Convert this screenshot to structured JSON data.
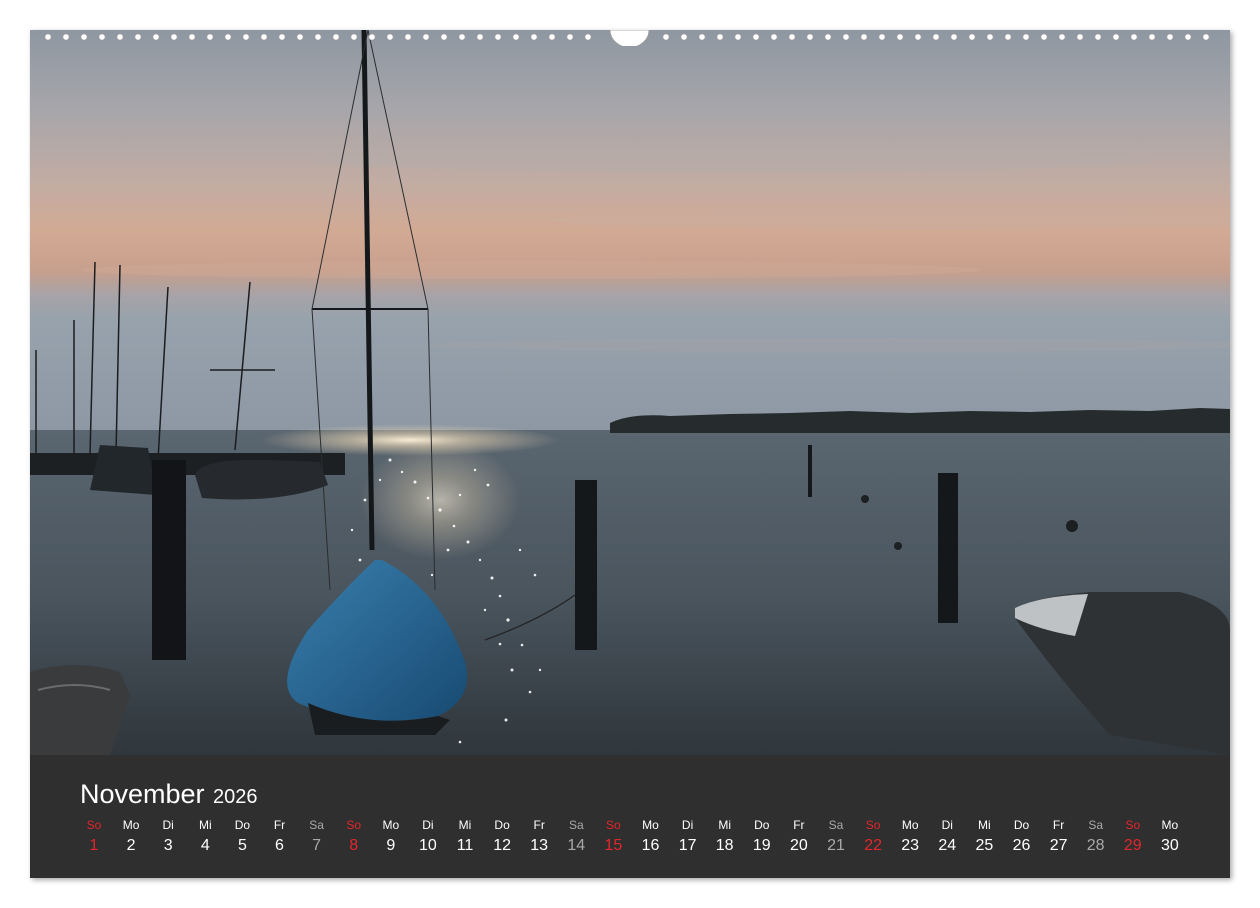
{
  "calendar": {
    "month": "November",
    "year": "2026",
    "days": [
      {
        "weekday": "So",
        "day": "1",
        "type": "sun"
      },
      {
        "weekday": "Mo",
        "day": "2",
        "type": "week"
      },
      {
        "weekday": "Di",
        "day": "3",
        "type": "week"
      },
      {
        "weekday": "Mi",
        "day": "4",
        "type": "week"
      },
      {
        "weekday": "Do",
        "day": "5",
        "type": "week"
      },
      {
        "weekday": "Fr",
        "day": "6",
        "type": "week"
      },
      {
        "weekday": "Sa",
        "day": "7",
        "type": "sat"
      },
      {
        "weekday": "So",
        "day": "8",
        "type": "sun"
      },
      {
        "weekday": "Mo",
        "day": "9",
        "type": "week"
      },
      {
        "weekday": "Di",
        "day": "10",
        "type": "week"
      },
      {
        "weekday": "Mi",
        "day": "11",
        "type": "week"
      },
      {
        "weekday": "Do",
        "day": "12",
        "type": "week"
      },
      {
        "weekday": "Fr",
        "day": "13",
        "type": "week"
      },
      {
        "weekday": "Sa",
        "day": "14",
        "type": "sat"
      },
      {
        "weekday": "So",
        "day": "15",
        "type": "sun"
      },
      {
        "weekday": "Mo",
        "day": "16",
        "type": "week"
      },
      {
        "weekday": "Di",
        "day": "17",
        "type": "week"
      },
      {
        "weekday": "Mi",
        "day": "18",
        "type": "week"
      },
      {
        "weekday": "Do",
        "day": "19",
        "type": "week"
      },
      {
        "weekday": "Fr",
        "day": "20",
        "type": "week"
      },
      {
        "weekday": "Sa",
        "day": "21",
        "type": "sat"
      },
      {
        "weekday": "So",
        "day": "22",
        "type": "sun"
      },
      {
        "weekday": "Mo",
        "day": "23",
        "type": "week"
      },
      {
        "weekday": "Di",
        "day": "24",
        "type": "week"
      },
      {
        "weekday": "Mi",
        "day": "25",
        "type": "week"
      },
      {
        "weekday": "Do",
        "day": "26",
        "type": "week"
      },
      {
        "weekday": "Fr",
        "day": "27",
        "type": "week"
      },
      {
        "weekday": "Sa",
        "day": "28",
        "type": "sat"
      },
      {
        "weekday": "So",
        "day": "29",
        "type": "sun"
      },
      {
        "weekday": "Mo",
        "day": "30",
        "type": "week"
      }
    ]
  },
  "colors": {
    "panel": "#2f2f2f",
    "weekday_text": "#ffffff",
    "saturday_text": "#a9a9a9",
    "sunday_text": "#e3262b"
  }
}
